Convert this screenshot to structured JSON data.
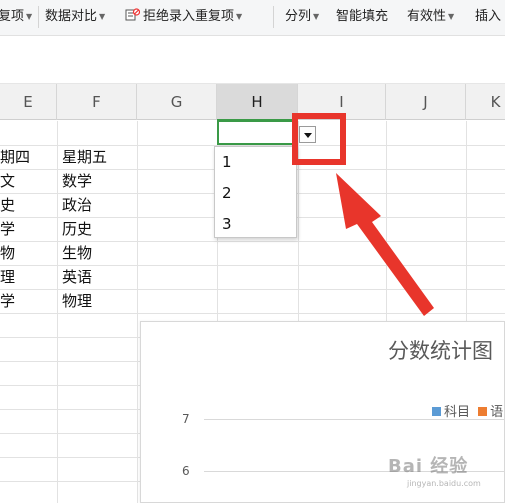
{
  "ribbon": {
    "items": [
      {
        "label": "复项",
        "has_caret": true
      },
      {
        "label": "数据对比",
        "has_caret": true
      },
      {
        "label": "拒绝录入重复项",
        "has_caret": true
      },
      {
        "label": "分列",
        "has_caret": true
      },
      {
        "label": "智能填充",
        "has_caret": false
      },
      {
        "label": "有效性",
        "has_caret": true
      },
      {
        "label": "插入",
        "has_caret": false
      }
    ]
  },
  "columns": [
    "E",
    "F",
    "G",
    "H",
    "I",
    "J",
    "K"
  ],
  "active_column": "H",
  "rows": [
    {
      "e": "期四",
      "f": "星期五"
    },
    {
      "e": "文",
      "f": "数学"
    },
    {
      "e": "史",
      "f": "政治"
    },
    {
      "e": "学",
      "f": "历史"
    },
    {
      "e": "物",
      "f": "生物"
    },
    {
      "e": "理",
      "f": "英语"
    },
    {
      "e": "学",
      "f": "物理"
    }
  ],
  "dropdown": {
    "options": [
      "1",
      "2",
      "3"
    ]
  },
  "chart": {
    "title": "分数统计图",
    "legend": [
      {
        "label": "科目",
        "color": "#5b9bd5"
      },
      {
        "label": "语",
        "color": "#ed7d31"
      }
    ],
    "y_ticks": [
      "7",
      "6"
    ]
  },
  "colors": {
    "accent_green": "#3a9a47",
    "highlight_red": "#e8352b"
  },
  "watermark": {
    "text": "Bai 经验",
    "sub": "jingyan.baidu.com"
  }
}
